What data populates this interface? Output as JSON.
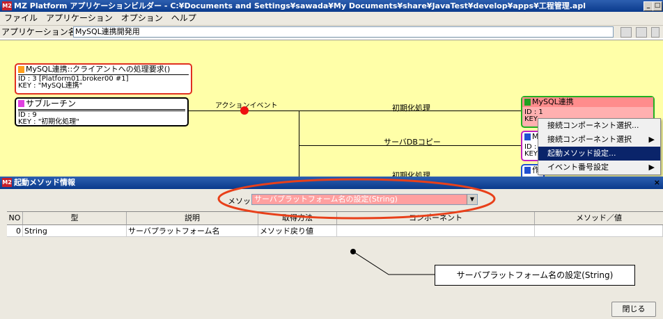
{
  "window": {
    "logo": "M2",
    "title": "MZ Platform アプリケーションビルダー - C:¥Documents and Settings¥sawada¥My Documents¥share¥JavaTest¥develop¥apps¥工程管理.apl",
    "minimize": "_",
    "restore": "□"
  },
  "menu": [
    "ファイル",
    "アプリケーション",
    "オプション",
    "ヘルプ"
  ],
  "app_name": {
    "label": "アプリケーション名称",
    "value": "MySQL連携開発用"
  },
  "canvas": {
    "request_node": {
      "title": "MySQL連携::クライアントへの処理要求()",
      "id": "ID : 3 [Platform01.broker00 #1]",
      "key": "KEY : \"MySQL連携\""
    },
    "subroutine_node": {
      "title": "サブルーチン",
      "id": "ID : 9",
      "key": "KEY : \"初期化処理\""
    },
    "action_event_label": "アクションイベント",
    "branch_labels": [
      "初期化処理",
      "サーバDBコピー",
      "初期化処理"
    ],
    "mysql_node": {
      "title": "MySQL連携",
      "id": "ID : 1",
      "key": "KEY"
    },
    "node2": {
      "title": "M",
      "id": "ID :",
      "key": "KEY"
    },
    "node3": {
      "title": "作"
    }
  },
  "context_menu": {
    "items": [
      {
        "label": "接続コンポーネント選択...",
        "arrow": ""
      },
      {
        "label": "接続コンポーネント選択",
        "arrow": "▶"
      },
      {
        "label": "起動メソッド設定...",
        "arrow": ""
      },
      {
        "label": "イベント番号設定",
        "arrow": "▶"
      }
    ],
    "selected_index": 2
  },
  "panel": {
    "title": "起動メソッド情報",
    "close_x": "×",
    "method_label": "メソッド",
    "method_value": "サーバプラットフォーム名の設定(String)",
    "dropdown_arrow": "▼",
    "columns": [
      "NO",
      "型",
      "説明",
      "取得方法",
      "コンポーネント",
      "メソッド／値"
    ],
    "rows": [
      {
        "no": "0",
        "type": "String",
        "desc": "サーバプラットフォーム名",
        "method": "メソッド戻り値",
        "component": "",
        "value": ""
      }
    ],
    "close_button": "閉じる"
  },
  "callout": {
    "text": "サーバプラットフォーム名の設定(String)"
  },
  "colors": {
    "titlebar": "#0a3a8c",
    "canvas_bg": "#ffffa8",
    "annotation_red": "#e8401a",
    "selection": "#0a246a",
    "method_select_bg": "#ffa0a0"
  }
}
